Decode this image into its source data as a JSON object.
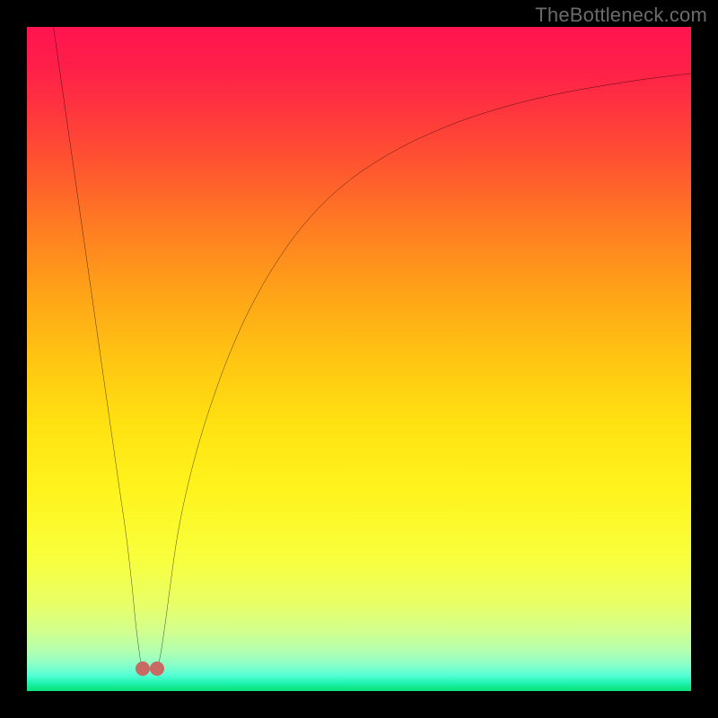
{
  "watermark": "TheBottleneck.com",
  "colors": {
    "frame": "#000000",
    "dot": "#c86a63",
    "curve": "#000000",
    "gradient_stops": [
      {
        "offset": 0.0,
        "color": "#ff1450"
      },
      {
        "offset": 0.06,
        "color": "#ff1f49"
      },
      {
        "offset": 0.12,
        "color": "#ff333f"
      },
      {
        "offset": 0.2,
        "color": "#ff5231"
      },
      {
        "offset": 0.3,
        "color": "#ff7c22"
      },
      {
        "offset": 0.4,
        "color": "#ffa318"
      },
      {
        "offset": 0.5,
        "color": "#ffc512"
      },
      {
        "offset": 0.6,
        "color": "#ffe211"
      },
      {
        "offset": 0.7,
        "color": "#fff41e"
      },
      {
        "offset": 0.8,
        "color": "#f8ff3c"
      },
      {
        "offset": 0.87,
        "color": "#e8ff68"
      },
      {
        "offset": 0.91,
        "color": "#d2ff8e"
      },
      {
        "offset": 0.94,
        "color": "#b2ffb0"
      },
      {
        "offset": 0.96,
        "color": "#8affc8"
      },
      {
        "offset": 0.975,
        "color": "#5affd6"
      },
      {
        "offset": 0.985,
        "color": "#2cf7bc"
      },
      {
        "offset": 0.992,
        "color": "#16ec9a"
      },
      {
        "offset": 1.0,
        "color": "#0ce07a"
      }
    ]
  },
  "chart_data": {
    "type": "line",
    "title": "",
    "xlabel": "",
    "ylabel": "",
    "xlim": [
      0,
      100
    ],
    "ylim": [
      0,
      100
    ],
    "series": [
      {
        "name": "left-branch",
        "x": [
          4.0,
          5.0,
          6.0,
          7.0,
          8.0,
          9.0,
          10.0,
          11.0,
          12.0,
          13.0,
          14.0,
          15.0,
          15.8,
          16.4,
          16.9,
          17.2,
          17.4
        ],
        "y": [
          100.0,
          93.0,
          86.0,
          79.0,
          72.0,
          65.0,
          58.0,
          51.0,
          44.0,
          37.0,
          30.0,
          23.0,
          16.0,
          10.0,
          6.0,
          4.0,
          3.4
        ]
      },
      {
        "name": "right-branch",
        "x": [
          19.6,
          19.8,
          20.2,
          20.8,
          21.6,
          22.6,
          24.0,
          25.8,
          28.0,
          30.6,
          33.8,
          37.6,
          42.0,
          47.2,
          53.4,
          60.8,
          69.4,
          79.4,
          90.8,
          100.0
        ],
        "y": [
          3.4,
          4.0,
          6.0,
          10.0,
          16.0,
          23.0,
          30.0,
          37.0,
          44.0,
          51.0,
          58.0,
          64.6,
          70.6,
          75.8,
          80.2,
          84.0,
          87.2,
          89.8,
          91.8,
          93.0
        ]
      }
    ],
    "markers": [
      {
        "name": "endpoint-left",
        "x": 17.4,
        "y": 3.4
      },
      {
        "name": "endpoint-right",
        "x": 19.6,
        "y": 3.4
      }
    ],
    "valley_floor_band_y": 3.0
  }
}
